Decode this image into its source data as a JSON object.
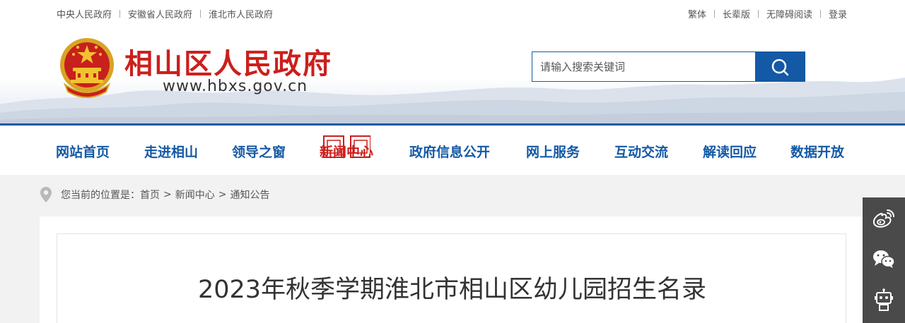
{
  "top_links": {
    "left": [
      "中央人民政府",
      "安徽省人民政府",
      "淮北市人民政府"
    ],
    "right": [
      "繁体",
      "长辈版",
      "无障碍阅读",
      "登录"
    ]
  },
  "header": {
    "site_name": "相山区人民政府",
    "site_url": "www.hbxs.gov.cn"
  },
  "search": {
    "placeholder": "请输入搜索关键词"
  },
  "nav": {
    "items": [
      "网站首页",
      "走进相山",
      "领导之窗",
      "新闻中心",
      "政府信息公开",
      "网上服务",
      "互动交流",
      "解读回应",
      "数据开放"
    ],
    "active_index": 3
  },
  "breadcrumb": {
    "prefix": "您当前的位置是：",
    "items": [
      "首页",
      "新闻中心",
      "通知公告"
    ],
    "separator": ">"
  },
  "article": {
    "title": "2023年秋季学期淮北市相山区幼儿园招生名录"
  },
  "colors": {
    "primary_blue": "#1459a5",
    "brand_red": "#cc1f1c",
    "sidebar_bg": "#4a4a4a"
  },
  "sidebar": {
    "icons": [
      "weibo-icon",
      "wechat-icon",
      "robot-icon"
    ]
  }
}
